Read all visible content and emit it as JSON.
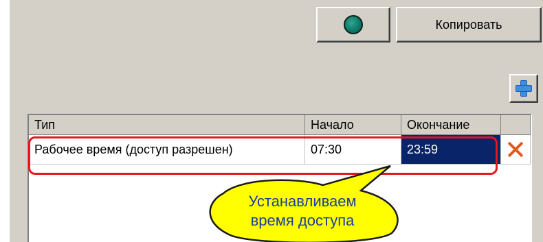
{
  "toolbar": {
    "status_indicator_color": "#1a8f7a",
    "copy_label": "Копировать"
  },
  "grid": {
    "columns": [
      "Тип",
      "Начало",
      "Окончание"
    ],
    "rows": [
      {
        "type": "Рабочее время (доступ разрешен)",
        "start": "07:30",
        "end": "23:59"
      }
    ],
    "add_icon": "plus-icon",
    "delete_icon": "delete-x-icon",
    "selected_cell_color": "#0a246a"
  },
  "annotation": {
    "line1": "Устанавливаем",
    "line2": "время доступа",
    "highlight_color": "#e8141b",
    "bubble_color": "#ffff00"
  }
}
